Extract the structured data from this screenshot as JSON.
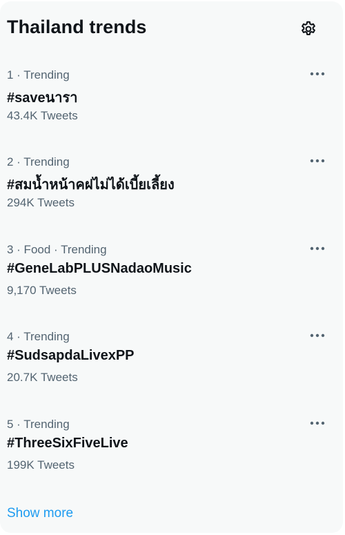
{
  "header": {
    "title": "Thailand trends",
    "settings_icon": "gear-icon"
  },
  "trends": [
    {
      "meta": "1 · Trending",
      "name": "#saveนารา",
      "count": "43.4K Tweets",
      "more_icon": "more-options-icon"
    },
    {
      "meta": "2 · Trending",
      "name": "#สมน้ำหน้าคฝไม่ได้เบี้ยเลี้ยง",
      "count": "294K Tweets",
      "more_icon": "more-options-icon"
    },
    {
      "meta": "3 · Food · Trending",
      "name": "#GeneLabPLUSNadaoMusic",
      "count": "9,170 Tweets",
      "more_icon": "more-options-icon"
    },
    {
      "meta": "4 · Trending",
      "name": "#SudsapdaLivexPP",
      "count": "20.7K Tweets",
      "more_icon": "more-options-icon"
    },
    {
      "meta": "5 · Trending",
      "name": "#ThreeSixFiveLive",
      "count": "199K Tweets",
      "more_icon": "more-options-icon"
    }
  ],
  "footer": {
    "show_more": "Show more"
  },
  "colors": {
    "panel_background": "#f7f9f9",
    "primary_text": "#0f1419",
    "secondary_text": "#536471",
    "link": "#1d9bf0"
  }
}
